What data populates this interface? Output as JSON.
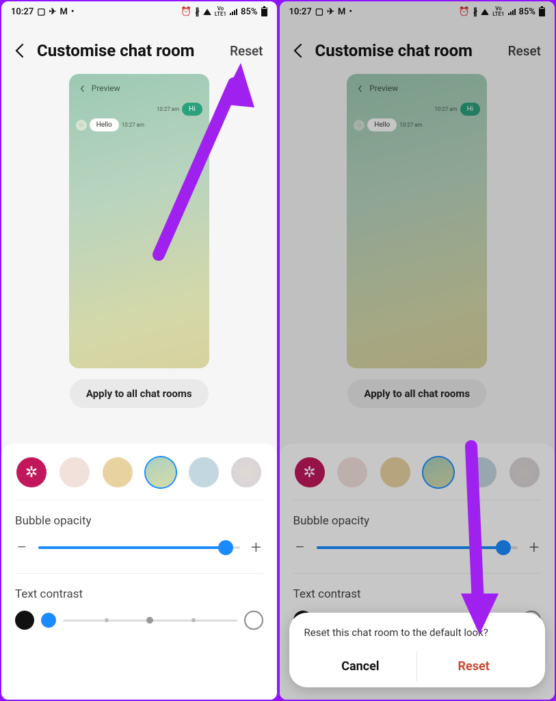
{
  "status": {
    "time": "10:27",
    "lte_label": "LTE1",
    "vo_label": "Vo",
    "battery_pct": "85%"
  },
  "header": {
    "title": "Customise chat room",
    "reset": "Reset"
  },
  "preview": {
    "label": "Preview",
    "msg_out": "Hi",
    "msg_in": "Hello",
    "time_out": "10:27 am",
    "time_in": "10:27 am"
  },
  "apply_button": "Apply to all chat rooms",
  "opacity": {
    "label": "Bubble opacity",
    "value_pct": 93
  },
  "contrast": {
    "label": "Text contrast"
  },
  "dialog": {
    "message": "Reset this chat room to the default look?",
    "cancel": "Cancel",
    "reset": "Reset"
  }
}
